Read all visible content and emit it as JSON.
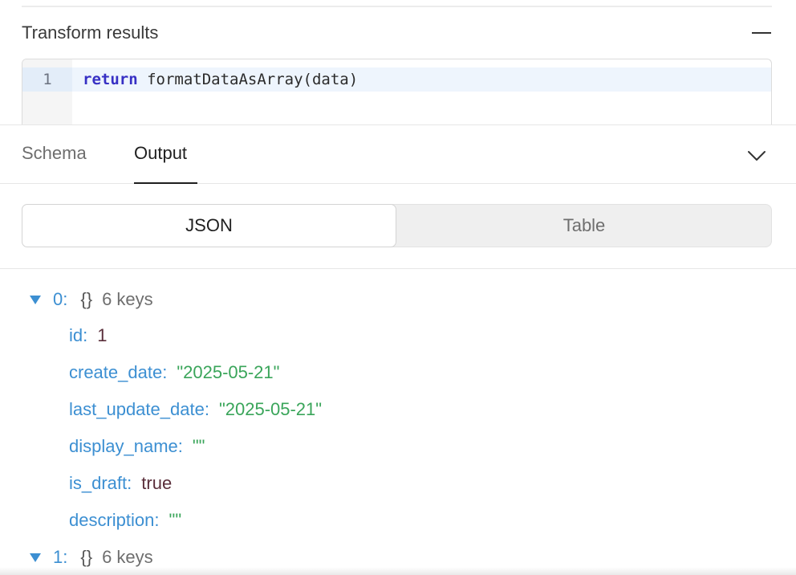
{
  "transform": {
    "title": "Transform results",
    "collapse_icon": "minus-icon",
    "editor": {
      "line_number": "1",
      "keyword": "return",
      "code_rest": " formatDataAsArray(data)"
    }
  },
  "tabs": {
    "schema": "Schema",
    "output": "Output",
    "active": "Output",
    "chevron_icon": "chevron-down-icon"
  },
  "view_toggle": {
    "json": "JSON",
    "table": "Table",
    "selected": "JSON"
  },
  "tree": {
    "items": [
      {
        "index": "0:",
        "brace": "{}",
        "count": "6 keys",
        "expanded": true,
        "fields": [
          {
            "key": "id:",
            "value": "1"
          },
          {
            "key": "create_date:",
            "value": "\"2025-05-21\""
          },
          {
            "key": "last_update_date:",
            "value": "\"2025-05-21\""
          },
          {
            "key": "display_name:",
            "value": "\"\""
          },
          {
            "key": "is_draft:",
            "value": "true"
          },
          {
            "key": "description:",
            "value": "\"\""
          }
        ]
      },
      {
        "index": "1:",
        "brace": "{}",
        "count": "6 keys",
        "expanded": false
      }
    ]
  },
  "colors": {
    "key": "#3c8fd2",
    "string": "#3aa55a",
    "number": "#5a2e3a",
    "keyword": "#3730c4"
  }
}
